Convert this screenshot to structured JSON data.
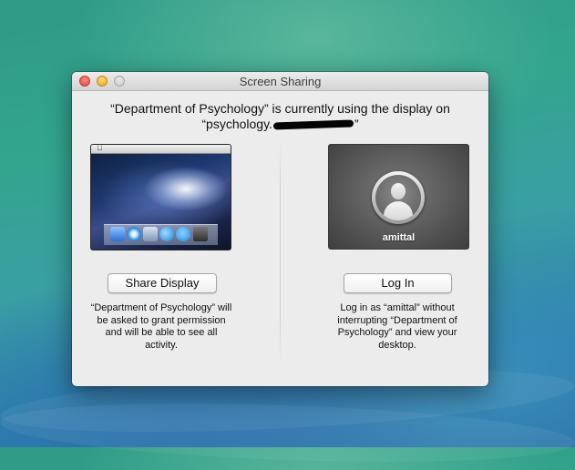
{
  "window": {
    "title": "Screen Sharing"
  },
  "message": {
    "line1": "“Department of Psychology” is currently using the display on",
    "line2_prefix": "“psychology.",
    "line2_suffix": "”"
  },
  "options": {
    "share": {
      "button_label": "Share Display",
      "description": "“Department of Psychology” will be asked to grant permission and will be able to see all activity."
    },
    "login": {
      "button_label": "Log In",
      "username": "amittal",
      "description": "Log in as “amittal” without interrupting “Department of Psychology” and view your desktop."
    }
  },
  "icons": {
    "menubar_logo": ""
  },
  "colors": {
    "window_bg": "#ececec",
    "close": "#e0443e",
    "minimize": "#e3a81f",
    "zoom_disabled": "#c8c8c8"
  }
}
